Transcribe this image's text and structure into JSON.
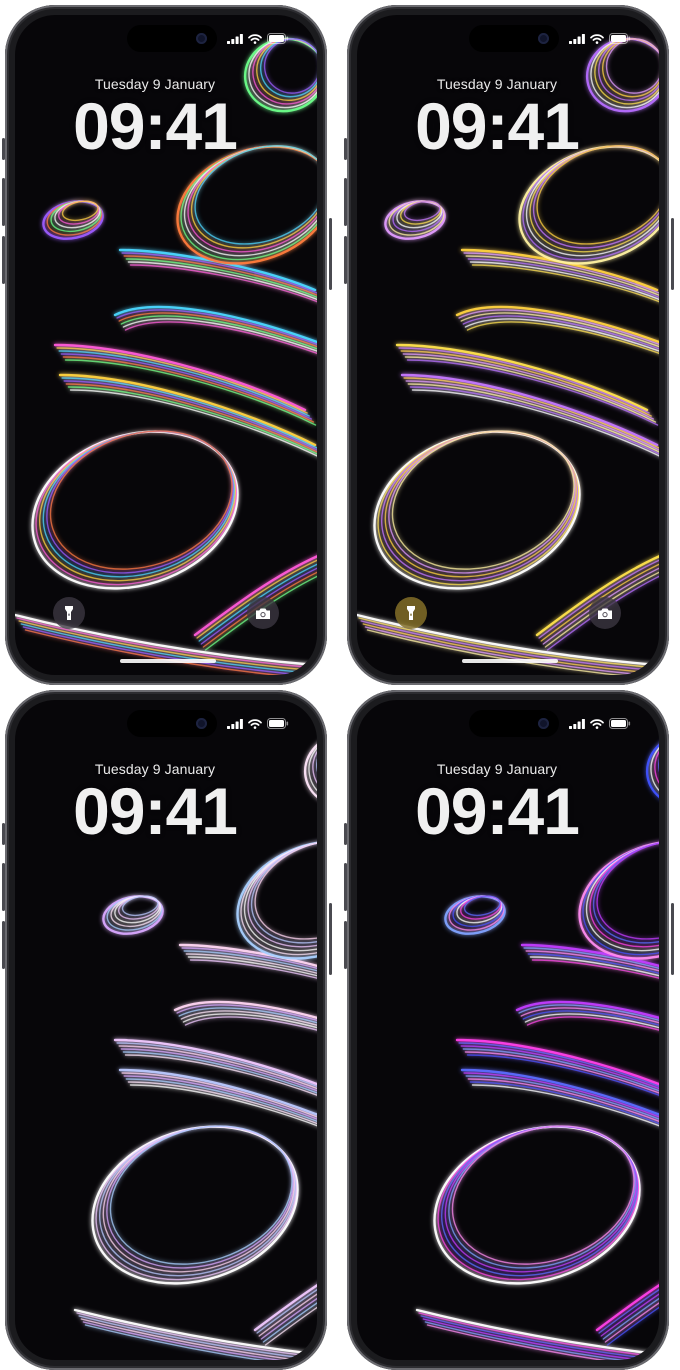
{
  "lock_screens": [
    {
      "id": "screen-1",
      "date": "Tuesday 9 January",
      "time": "09:41",
      "palette": "rainbow"
    },
    {
      "id": "screen-2",
      "date": "Tuesday 9 January",
      "time": "09:41",
      "palette": "yellow-purple"
    },
    {
      "id": "screen-3",
      "date": "Tuesday 9 January",
      "time": "09:41",
      "palette": "pastel"
    },
    {
      "id": "screen-4",
      "date": "Tuesday 9 January",
      "time": "09:41",
      "palette": "magenta-blue"
    }
  ],
  "icons": {
    "flashlight": "flashlight-icon",
    "camera": "camera-icon",
    "signal": "cellular-signal-icon",
    "wifi": "wifi-icon",
    "battery": "battery-icon"
  },
  "palettes": {
    "rainbow": [
      "#ffffff",
      "#ff5ad9",
      "#ffd23c",
      "#49d7ff",
      "#9b5bff",
      "#ff7a3c",
      "#6cff8a"
    ],
    "yellow-purple": [
      "#ffffff",
      "#ffe14a",
      "#c477ff",
      "#ffd23c",
      "#e09bff",
      "#fff2a0",
      "#b56cff"
    ],
    "pastel": [
      "#ffffff",
      "#f0c8ff",
      "#b9c8ff",
      "#ffd6f2",
      "#d8a8ff",
      "#a8d0ff",
      "#ffe6fa"
    ],
    "magenta-blue": [
      "#ffffff",
      "#ff3fe8",
      "#5a6bff",
      "#c23bff",
      "#7fa2ff",
      "#ff8bf0",
      "#3f52ff"
    ]
  }
}
